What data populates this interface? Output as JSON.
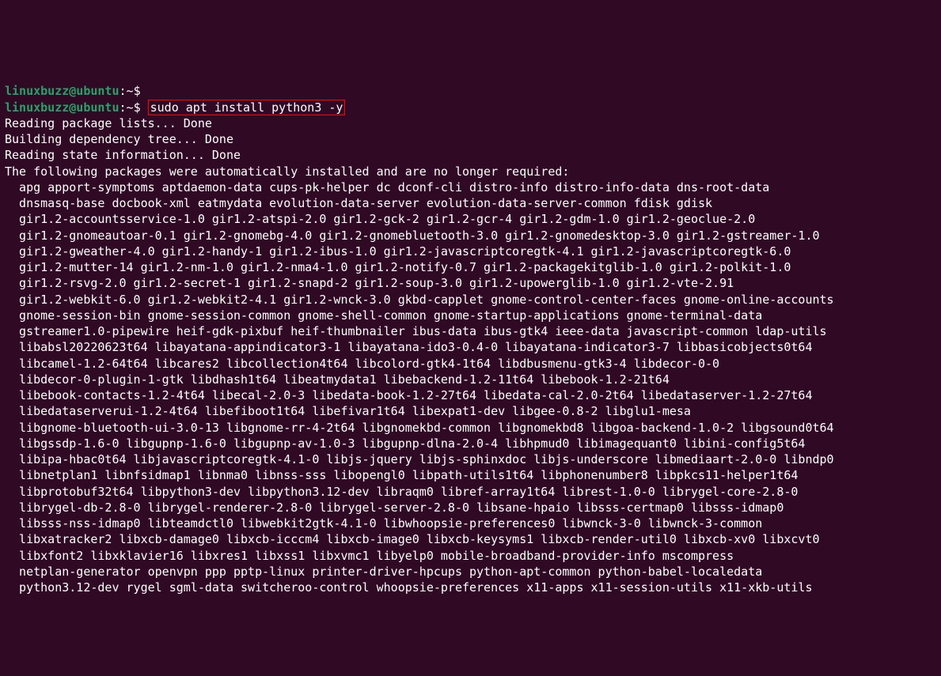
{
  "prompt": {
    "user": "linuxbuzz@ubuntu",
    "sep": ":",
    "path": "~",
    "dollar": "$"
  },
  "command": "sudo apt install python3 -y",
  "output": {
    "line1": "Reading package lists... Done",
    "line2": "Building dependency tree... Done",
    "line3": "Reading state information... Done",
    "line4": "The following packages were automatically installed and are no longer required:",
    "pkg1": "  apg apport-symptoms aptdaemon-data cups-pk-helper dc dconf-cli distro-info distro-info-data dns-root-data",
    "pkg2": "  dnsmasq-base docbook-xml eatmydata evolution-data-server evolution-data-server-common fdisk gdisk",
    "pkg3": "  gir1.2-accountsservice-1.0 gir1.2-atspi-2.0 gir1.2-gck-2 gir1.2-gcr-4 gir1.2-gdm-1.0 gir1.2-geoclue-2.0",
    "pkg4": "  gir1.2-gnomeautoar-0.1 gir1.2-gnomebg-4.0 gir1.2-gnomebluetooth-3.0 gir1.2-gnomedesktop-3.0 gir1.2-gstreamer-1.0",
    "pkg5": "  gir1.2-gweather-4.0 gir1.2-handy-1 gir1.2-ibus-1.0 gir1.2-javascriptcoregtk-4.1 gir1.2-javascriptcoregtk-6.0",
    "pkg6": "  gir1.2-mutter-14 gir1.2-nm-1.0 gir1.2-nma4-1.0 gir1.2-notify-0.7 gir1.2-packagekitglib-1.0 gir1.2-polkit-1.0",
    "pkg7": "  gir1.2-rsvg-2.0 gir1.2-secret-1 gir1.2-snapd-2 gir1.2-soup-3.0 gir1.2-upowerglib-1.0 gir1.2-vte-2.91",
    "pkg8": "  gir1.2-webkit-6.0 gir1.2-webkit2-4.1 gir1.2-wnck-3.0 gkbd-capplet gnome-control-center-faces gnome-online-accounts",
    "pkg9": "  gnome-session-bin gnome-session-common gnome-shell-common gnome-startup-applications gnome-terminal-data",
    "pkg10": "  gstreamer1.0-pipewire heif-gdk-pixbuf heif-thumbnailer ibus-data ibus-gtk4 ieee-data javascript-common ldap-utils",
    "pkg11": "  libabsl20220623t64 libayatana-appindicator3-1 libayatana-ido3-0.4-0 libayatana-indicator3-7 libbasicobjects0t64",
    "pkg12": "  libcamel-1.2-64t64 libcares2 libcollection4t64 libcolord-gtk4-1t64 libdbusmenu-gtk3-4 libdecor-0-0",
    "pkg13": "  libdecor-0-plugin-1-gtk libdhash1t64 libeatmydata1 libebackend-1.2-11t64 libebook-1.2-21t64",
    "pkg14": "  libebook-contacts-1.2-4t64 libecal-2.0-3 libedata-book-1.2-27t64 libedata-cal-2.0-2t64 libedataserver-1.2-27t64",
    "pkg15": "  libedataserverui-1.2-4t64 libefiboot1t64 libefivar1t64 libexpat1-dev libgee-0.8-2 libglu1-mesa",
    "pkg16": "  libgnome-bluetooth-ui-3.0-13 libgnome-rr-4-2t64 libgnomekbd-common libgnomekbd8 libgoa-backend-1.0-2 libgsound0t64",
    "pkg17": "  libgssdp-1.6-0 libgupnp-1.6-0 libgupnp-av-1.0-3 libgupnp-dlna-2.0-4 libhpmud0 libimagequant0 libini-config5t64",
    "pkg18": "  libipa-hbac0t64 libjavascriptcoregtk-4.1-0 libjs-jquery libjs-sphinxdoc libjs-underscore libmediaart-2.0-0 libndp0",
    "pkg19": "  libnetplan1 libnfsidmap1 libnma0 libnss-sss libopengl0 libpath-utils1t64 libphonenumber8 libpkcs11-helper1t64",
    "pkg20": "  libprotobuf32t64 libpython3-dev libpython3.12-dev libraqm0 libref-array1t64 librest-1.0-0 librygel-core-2.8-0",
    "pkg21": "  librygel-db-2.8-0 librygel-renderer-2.8-0 librygel-server-2.8-0 libsane-hpaio libsss-certmap0 libsss-idmap0",
    "pkg22": "  libsss-nss-idmap0 libteamdctl0 libwebkit2gtk-4.1-0 libwhoopsie-preferences0 libwnck-3-0 libwnck-3-common",
    "pkg23": "  libxatracker2 libxcb-damage0 libxcb-icccm4 libxcb-image0 libxcb-keysyms1 libxcb-render-util0 libxcb-xv0 libxcvt0",
    "pkg24": "  libxfont2 libxklavier16 libxres1 libxss1 libxvmc1 libyelp0 mobile-broadband-provider-info mscompress",
    "pkg25": "  netplan-generator openvpn ppp pptp-linux printer-driver-hpcups python-apt-common python-babel-localedata",
    "pkg26": "  python3.12-dev rygel sgml-data switcheroo-control whoopsie-preferences x11-apps x11-session-utils x11-xkb-utils"
  }
}
